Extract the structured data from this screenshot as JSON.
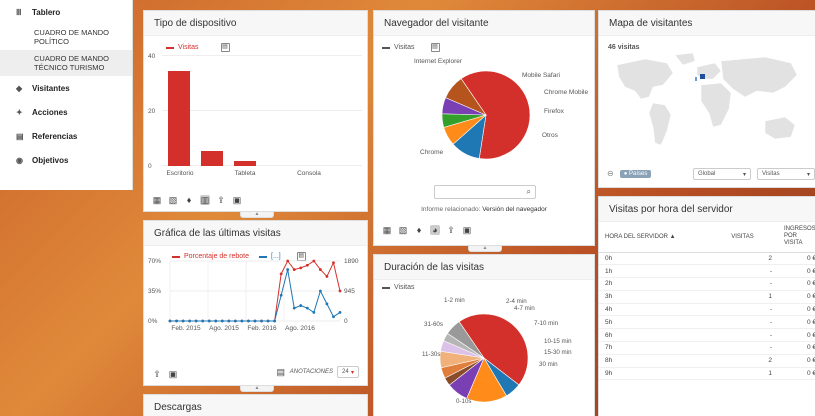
{
  "sidebar": {
    "items": [
      {
        "icon": "grid-icon",
        "glyph": "Ⅲ",
        "label": "Tablero"
      },
      {
        "icon": "eye-icon",
        "glyph": "👁",
        "label": "Visitantes"
      },
      {
        "icon": "bolt-icon",
        "glyph": "⚡",
        "label": "Acciones"
      },
      {
        "icon": "document-icon",
        "glyph": "▤",
        "label": "Referencias"
      },
      {
        "icon": "target-icon",
        "glyph": "◉",
        "label": "Objetivos"
      }
    ],
    "subitems": [
      "CUADRO DE MANDO POLÍTICO",
      "CUADRO DE MANDO TÉCNICO TURISMO"
    ]
  },
  "device": {
    "title": "Tipo de dispositivo",
    "legend": "Visitas",
    "color": "#d4302b",
    "chart_data": {
      "type": "bar",
      "categories": [
        "Escritorio",
        "Tableta",
        "Consola"
      ],
      "values": [
        38,
        6,
        2
      ],
      "ylim": [
        0,
        40
      ],
      "yticks": [
        "40",
        "20",
        "0"
      ]
    }
  },
  "browser": {
    "title": "Navegador del visitante",
    "legend": "Visitas",
    "labels": [
      "Internet Explorer",
      "Mobile Safari",
      "Chrome Mobile",
      "Firefox",
      "Otros",
      "Chrome"
    ],
    "search_icon": "search-icon",
    "related_prefix": "Informe relacionado: ",
    "related_link": "Versión del navegador",
    "chart_data": {
      "type": "pie",
      "categories": [
        "Chrome",
        "Internet Explorer",
        "Mobile Safari",
        "Chrome Mobile",
        "Firefox",
        "Otros"
      ],
      "values": [
        62,
        11,
        7,
        5,
        6,
        9
      ],
      "colors": [
        "#d4302b",
        "#1f78b4",
        "#ff8c1a",
        "#33a02c",
        "#7b3fb4",
        "#b5541c"
      ]
    }
  },
  "map": {
    "title": "Mapa de visitantes",
    "visits_label": "46 visitas",
    "button": "Países",
    "region_select": "Global",
    "metric_select": "Visitas"
  },
  "evolution": {
    "title": "Gráfica de las últimas visitas",
    "legend_1": "Porcentaje de rebote",
    "legend_2": "[...]",
    "annotations": "ANOTACIONES",
    "period": "24",
    "chart_data": {
      "type": "line",
      "xlabels": [
        "Feb. 2015",
        "Ago. 2015",
        "Feb. 2016",
        "Ago. 2016"
      ],
      "left_ticks": [
        "70%",
        "35%",
        "0%"
      ],
      "right_ticks": [
        "1890",
        "945",
        "0"
      ],
      "series": [
        {
          "name": "Porcentaje de rebote",
          "color": "#d4302b",
          "values": [
            0,
            0,
            0,
            0,
            0,
            0,
            0,
            0,
            0,
            0,
            0,
            0,
            0,
            0,
            0,
            0,
            0,
            55,
            70,
            60,
            62,
            65,
            70,
            60,
            52,
            68,
            35
          ]
        },
        {
          "name": "[...]",
          "color": "#1f78b4",
          "values": [
            0,
            0,
            0,
            0,
            0,
            0,
            0,
            0,
            0,
            0,
            0,
            0,
            0,
            0,
            0,
            0,
            0,
            30,
            60,
            15,
            18,
            15,
            10,
            35,
            20,
            5,
            10
          ]
        }
      ]
    }
  },
  "duration": {
    "title": "Duración de las visitas",
    "legend": "Visitas",
    "labels": [
      "1-2 min",
      "2-4 min",
      "4-7 min",
      "7-10 min",
      "10-15 min",
      "15-30 min",
      "30  min",
      "31-60s",
      "11-30s",
      "0-10s"
    ],
    "chart_data": {
      "type": "pie",
      "categories": [
        "0-10s",
        "11-30s",
        "31-60s",
        "1-2 min",
        "2-4 min",
        "4-7 min",
        "7-10 min",
        "10-15 min",
        "15-30 min",
        "30 min"
      ],
      "values": [
        45,
        6,
        15,
        8,
        3,
        4,
        6,
        4,
        3,
        6
      ],
      "colors": [
        "#d4302b",
        "#1f78b4",
        "#ff8c1a",
        "#7b3fb4",
        "#8a4b28",
        "#e07e3c",
        "#f0b27a",
        "#dcc2e8",
        "#b5b5b5",
        "#999999"
      ]
    }
  },
  "downloads": {
    "title": "Descargas"
  },
  "hours": {
    "title": "Visitas por hora del servidor",
    "col_hour": "HORA DEL SERVIDOR ▲",
    "col_visits": "VISITAS",
    "col_revenue": "INGRESOS POR VISITA",
    "rows": [
      {
        "hour": "0h",
        "visits": "2",
        "rev": "0 €"
      },
      {
        "hour": "1h",
        "visits": "-",
        "rev": "0 €"
      },
      {
        "hour": "2h",
        "visits": "-",
        "rev": "0 €"
      },
      {
        "hour": "3h",
        "visits": "1",
        "rev": "0 €"
      },
      {
        "hour": "4h",
        "visits": "-",
        "rev": "0 €"
      },
      {
        "hour": "5h",
        "visits": "-",
        "rev": "0 €"
      },
      {
        "hour": "6h",
        "visits": "-",
        "rev": "0 €"
      },
      {
        "hour": "7h",
        "visits": "-",
        "rev": "0 €"
      },
      {
        "hour": "8h",
        "visits": "2",
        "rev": "0 €"
      },
      {
        "hour": "9h",
        "visits": "1",
        "rev": "0 €"
      }
    ]
  }
}
